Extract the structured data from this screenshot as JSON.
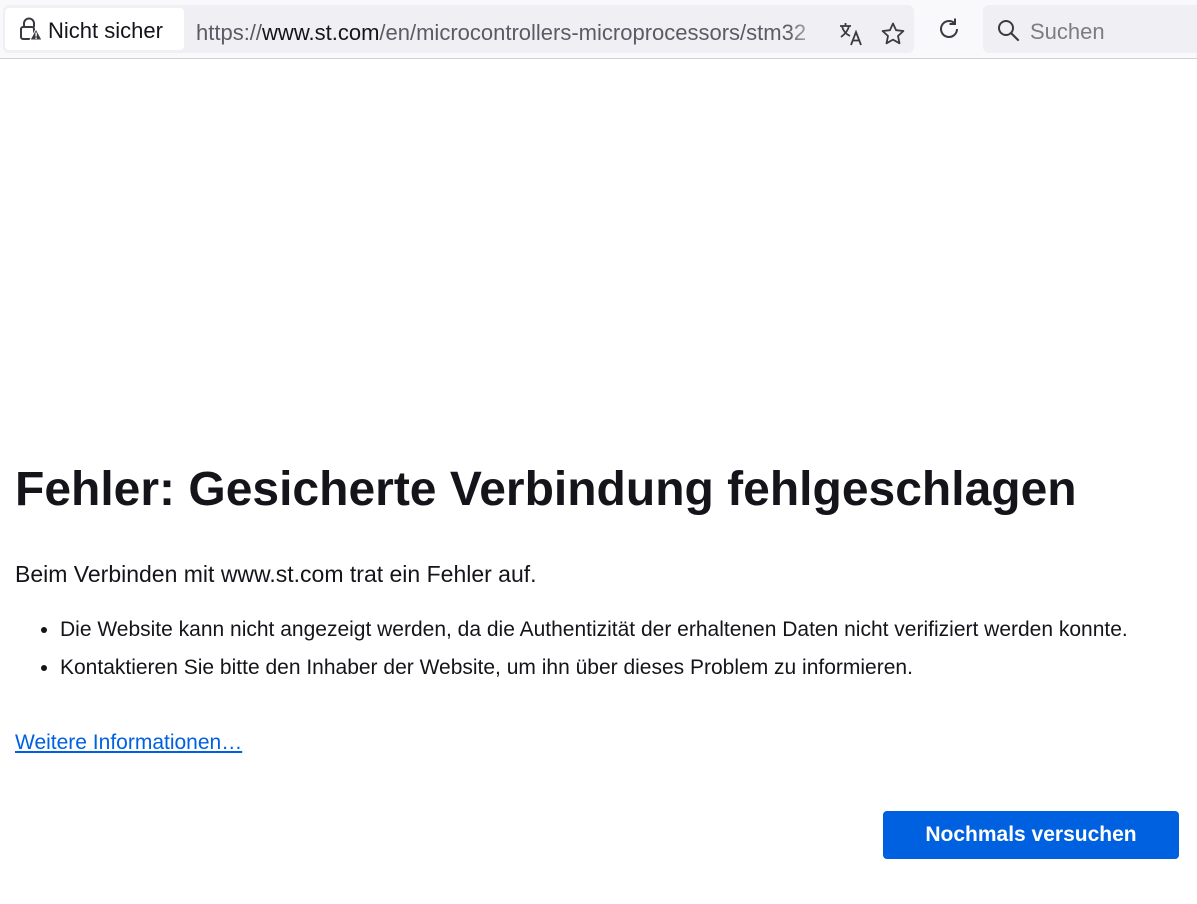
{
  "browser": {
    "identity_label": "Nicht sicher",
    "url_prefix": "https://",
    "url_host": "www.st.com",
    "url_path": "/en/microcontrollers-microprocessors/stm32",
    "search_placeholder": "Suchen",
    "icons": {
      "lock": "insecure-lock-icon",
      "translate": "translate-icon",
      "bookmark": "star-icon",
      "reload": "reload-icon",
      "search": "search-icon"
    }
  },
  "error_page": {
    "title": "Fehler: Gesicherte Verbindung fehlgeschlagen",
    "intro": "Beim Verbinden mit www.st.com trat ein Fehler auf.",
    "bullets": [
      "Die Website kann nicht angezeigt werden, da die Authentizität der erhaltenen Daten nicht verifiziert werden konnte.",
      "Kontaktieren Sie bitte den Inhaber der Website, um ihn über dieses Problem zu informieren."
    ],
    "more_info_link": "Weitere Informationen…",
    "retry_button": "Nochmals versuchen"
  },
  "colors": {
    "accent": "#0061e0",
    "text": "#15141a",
    "toolbar_bg": "#f9f9fb",
    "field_bg": "#f0f0f4"
  }
}
